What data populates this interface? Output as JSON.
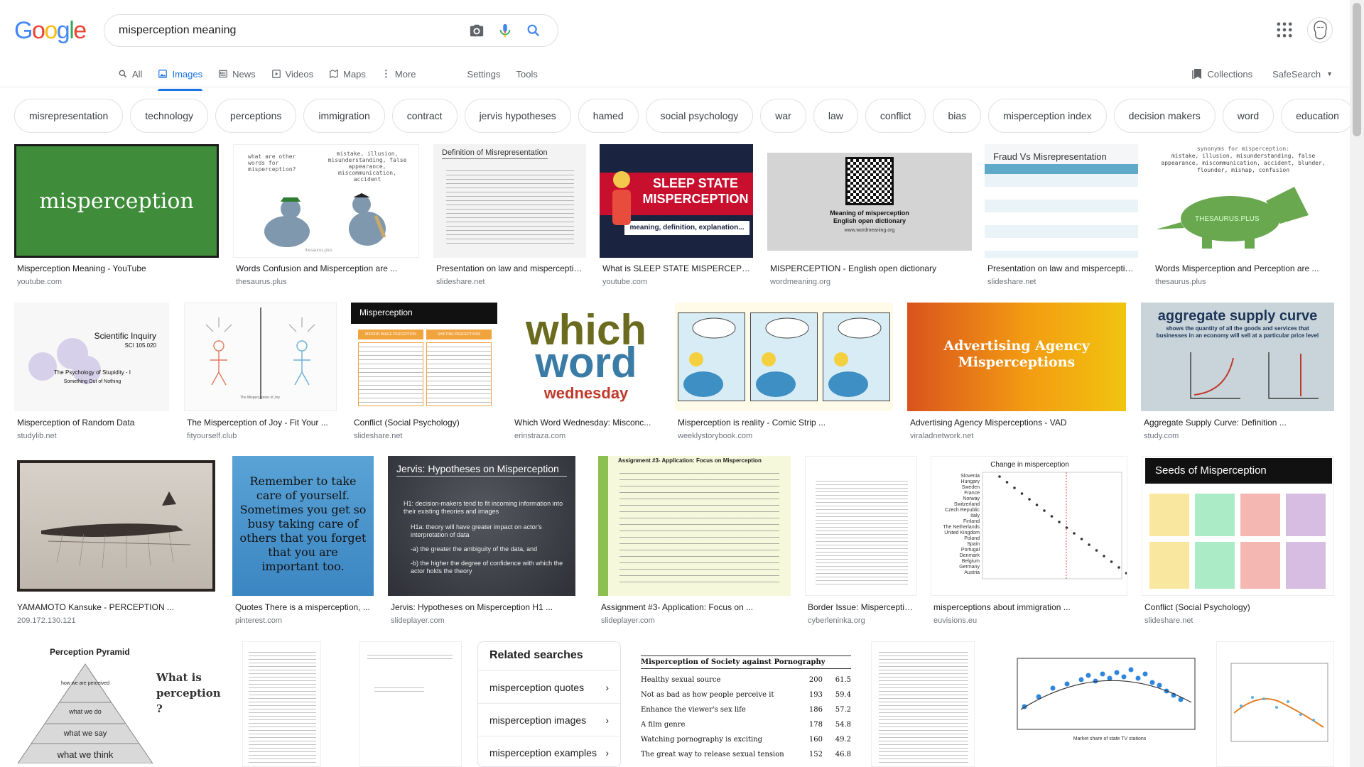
{
  "logo": "Google",
  "search": {
    "query": "misperception meaning"
  },
  "tabs": [
    "All",
    "Images",
    "News",
    "Videos",
    "Maps",
    "More"
  ],
  "tools": [
    "Settings",
    "Tools"
  ],
  "header_right": {
    "collections": "Collections",
    "safesearch": "SafeSearch"
  },
  "chips": [
    "misrepresentation",
    "technology",
    "perceptions",
    "immigration",
    "contract",
    "jervis hypotheses",
    "hamed",
    "social psychology",
    "war",
    "law",
    "conflict",
    "bias",
    "misperception index",
    "decision makers",
    "word",
    "education"
  ],
  "row1": [
    {
      "caption": "Misperception Meaning - YouTube",
      "source": "youtube.com",
      "text": "misperception"
    },
    {
      "caption": "Words Confusion and Misperception are ...",
      "source": "thesaurus.plus",
      "text": "what are other words for misperception?",
      "text2": "mistake, illusion, misunderstanding, false appearance, miscommunication, accident",
      "text3": "thesaurus.plus"
    },
    {
      "caption": "Presentation on law and misperception ...",
      "source": "slideshare.net",
      "text": "Definition of Misrepresentation"
    },
    {
      "caption": "What is SLEEP STATE MISPERCEPTION ...",
      "source": "youtube.com",
      "text": "SLEEP STATE MISPERCEPTION",
      "text2": "meaning, definition, explanation..."
    },
    {
      "caption": "MISPERCEPTION - English open dictionary",
      "source": "wordmeaning.org",
      "text": "Meaning of misperception English open dictionary",
      "text2": "www.wordmeaning.org"
    },
    {
      "caption": "Presentation on law and misperception ...",
      "source": "slideshare.net",
      "text": "Fraud Vs Misrepresentation"
    },
    {
      "caption": "Words Misperception and Perception are ...",
      "source": "thesaurus.plus",
      "text": "synonyms for misperception:",
      "text2": "mistake, illusion, misunderstanding, false appearance, miscommunication, accident, blunder, flounder, mishap, confusion",
      "text3": "THESAURUS.PLUS"
    }
  ],
  "row2": [
    {
      "caption": "Misperception of Random Data",
      "source": "studylib.net",
      "text": "Scientific Inquiry",
      "text2": "SCI 105.020",
      "text3": "The Psychology of Stupidity - I",
      "text4": "Something Out of Nothing"
    },
    {
      "caption": "The Misperception of Joy - Fit Your ...",
      "source": "fityourself.club",
      "text": "The Misperception of Joy"
    },
    {
      "caption": "Conflict (Social Psychology)",
      "source": "slideshare.net",
      "text": "Misperception",
      "text2": "MIRROR IMAGE PERCEPTION",
      "text3": "SHIFTING PERCEPTIONS"
    },
    {
      "caption": "Which Word Wednesday: Misconc...",
      "source": "erinstraza.com",
      "text": "which",
      "text2": "word",
      "text3": "wednesday"
    },
    {
      "caption": "Misperception is reality - Comic Strip ...",
      "source": "weeklystorybook.com"
    },
    {
      "caption": "Advertising Agency Misperceptions - VAD",
      "source": "viraladnetwork.net",
      "text": "Advertising Agency Misperceptions"
    },
    {
      "caption": "Aggregate Supply Curve: Definition ...",
      "source": "study.com",
      "text": "aggregate supply curve",
      "text2": "shows the quantity of all the goods and services that businesses in an economy will sell at a particular price level"
    }
  ],
  "row3": [
    {
      "caption": "YAMAMOTO Kansuke - PERCEPTION ...",
      "source": "209.172.130.121"
    },
    {
      "caption": "Quotes There is a misperception, ...",
      "source": "pinterest.com",
      "text": "Remember to take care of yourself. Sometimes you get so busy taking care of others that you forget that you are important too."
    },
    {
      "caption": "Jervis: Hypotheses on Misperception H1 ...",
      "source": "slideplayer.com",
      "text": "Jervis: Hypotheses on Misperception",
      "b1": "H1: decision-makers tend to fit incoming information into their existing theories and images",
      "b2": "H1a: theory will have greater impact on actor's interpretation of data",
      "b3": "-a) the greater the ambiguity of the data, and",
      "b4": "-b) the higher the degree of confidence with which the actor holds the theory"
    },
    {
      "caption": "Assignment #3- Application: Focus on ...",
      "source": "slideplayer.com",
      "text": "Assignment #3- Application: Focus on Misperception"
    },
    {
      "caption": "Border Issue: Misperception ...",
      "source": "cyberleninka.org"
    },
    {
      "caption": "misperceptions about immigration ...",
      "source": "euvisions.eu",
      "text": "Change in misperception",
      "countries": [
        "Slovenia",
        "Hungary",
        "Sweden",
        "France",
        "Norway",
        "Switzerland",
        "Czech Republic",
        "Italy",
        "Finland",
        "The Netherlands",
        "United Kingdom",
        "Poland",
        "Spain",
        "Portugal",
        "Denmark",
        "Belgium",
        "Germany",
        "Austria"
      ]
    },
    {
      "caption": "Conflict (Social Psychology)",
      "source": "slideshare.net",
      "text": "Seeds of Misperception"
    }
  ],
  "row4": [
    {
      "text": "Perception Pyramid",
      "text2": "What is perception ?",
      "levels": [
        "how we are perceived",
        "what we do",
        "what we say",
        "what we think"
      ]
    },
    {},
    {},
    {
      "text": "Misperception of Society against Pornography",
      "rows": [
        [
          "Healthy sexual source",
          "200",
          "61.5"
        ],
        [
          "Not as bad as how people perceive it",
          "193",
          "59.4"
        ],
        [
          "Enhance the viewer's sex life",
          "186",
          "57.2"
        ],
        [
          "A film genre",
          "178",
          "54.8"
        ],
        [
          "Watching pornography is exciting",
          "160",
          "49.2"
        ],
        [
          "The great way to release sexual tension",
          "152",
          "46.8"
        ]
      ]
    },
    {},
    {
      "xlabel": "Market share of state TV stations"
    },
    {}
  ],
  "related": {
    "title": "Related searches",
    "items": [
      "misperception quotes",
      "misperception images",
      "misperception examples"
    ]
  },
  "colors": {
    "accent": "#1a73e8",
    "youtube_green": "#3f8d3a"
  }
}
